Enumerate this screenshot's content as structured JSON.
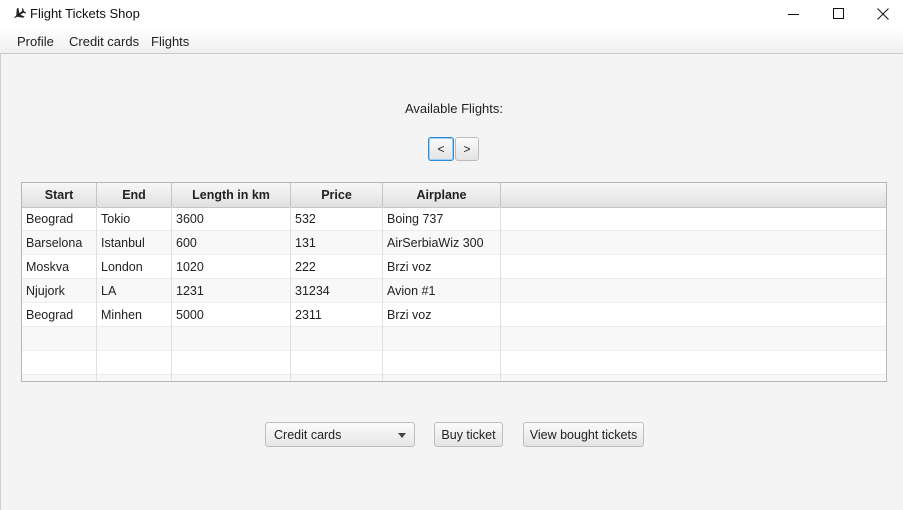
{
  "window": {
    "title": "Flight Tickets Shop",
    "app_icon": "airplane-icon",
    "controls": [
      "minimize-icon",
      "maximize-icon",
      "close-icon"
    ]
  },
  "menu": {
    "items": [
      {
        "label": "Profile"
      },
      {
        "label": "Credit cards"
      },
      {
        "label": "Flights"
      }
    ]
  },
  "main": {
    "heading": "Available Flights:",
    "prev_label": "<",
    "next_label": ">"
  },
  "table": {
    "columns": [
      "Start",
      "End",
      "Length in km",
      "Price",
      "Airplane"
    ],
    "rows": [
      [
        "Beograd",
        "Tokio",
        "3600",
        "532",
        "Boing 737"
      ],
      [
        "Barselona",
        "Istanbul",
        "600",
        "131",
        "AirSerbiaWiz 300"
      ],
      [
        "Moskva",
        "London",
        "1020",
        "222",
        "Brzi voz"
      ],
      [
        "Njujork",
        "LA",
        "1231",
        "31234",
        "Avion #1"
      ],
      [
        "Beograd",
        "Minhen",
        "5000",
        "2311",
        "Brzi voz"
      ]
    ]
  },
  "bottom": {
    "combo_value": "Credit cards",
    "buy_label": "Buy ticket",
    "view_label": "View bought tickets"
  }
}
